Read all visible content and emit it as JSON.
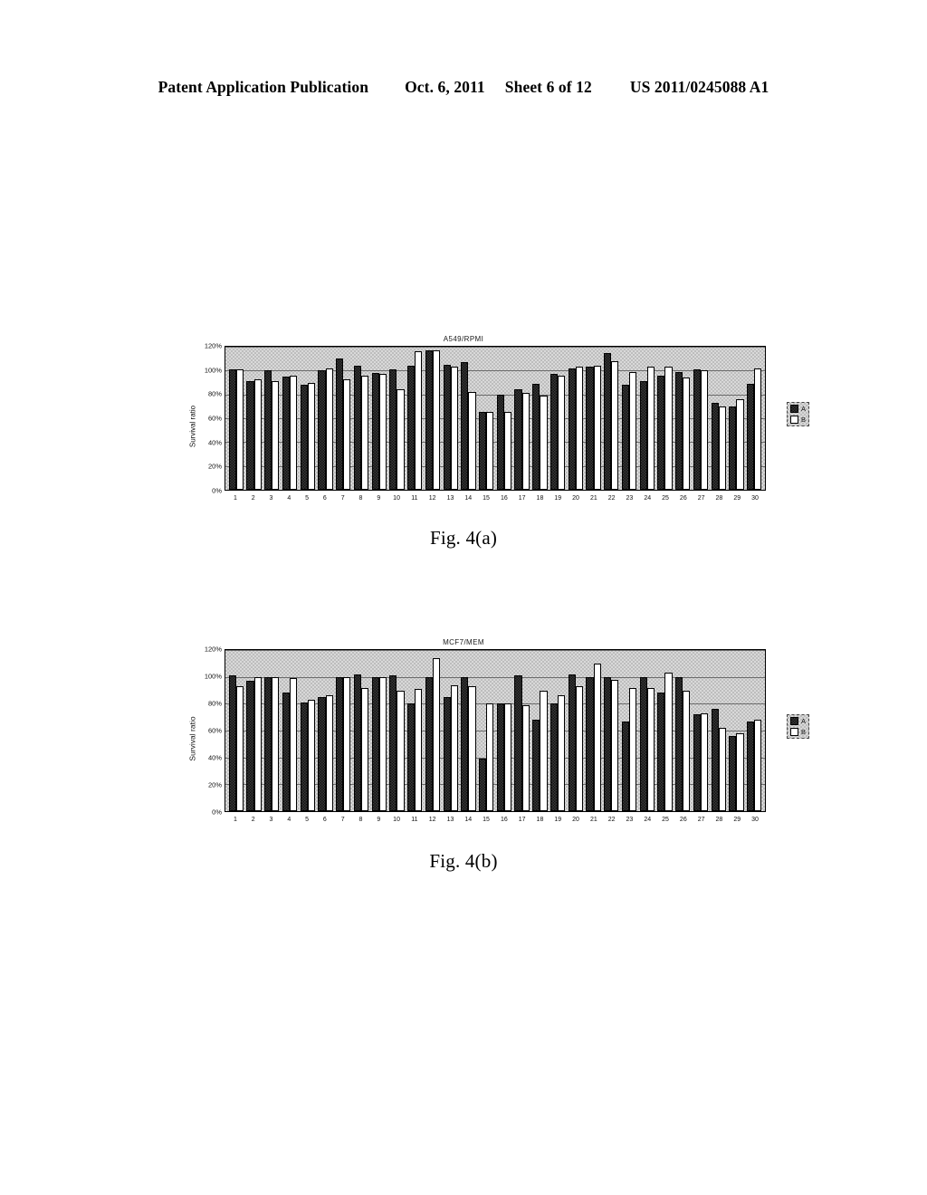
{
  "header": {
    "publication": "Patent Application Publication",
    "date": "Oct. 6, 2011",
    "sheet": "Sheet 6 of 12",
    "number": "US 2011/0245088 A1"
  },
  "figures": [
    {
      "caption": "Fig. 4(a)",
      "chart_data": {
        "type": "bar",
        "title": "A549/RPMI",
        "xlabel": "",
        "ylabel": "Survival ratio",
        "ylim": [
          0,
          120
        ],
        "ytick_labels": [
          "0%",
          "20%",
          "40%",
          "60%",
          "80%",
          "100%",
          "120%"
        ],
        "ytick_values": [
          0,
          20,
          40,
          60,
          80,
          100,
          120
        ],
        "grid": true,
        "legend_position": "right",
        "categories": [
          "1",
          "2",
          "3",
          "4",
          "5",
          "6",
          "7",
          "8",
          "9",
          "10",
          "11",
          "12",
          "13",
          "14",
          "15",
          "16",
          "17",
          "18",
          "19",
          "20",
          "21",
          "22",
          "23",
          "24",
          "25",
          "26",
          "27",
          "28",
          "29",
          "30"
        ],
        "series": [
          {
            "name": "A",
            "values": [
              101,
              91,
              100,
              95,
              88,
              100,
              110,
              104,
              98,
              101,
              104,
              117,
              105,
              107,
              65,
              80,
              84,
              89,
              97,
              102,
              103,
              115,
              88,
              91,
              96,
              99,
              101,
              73,
              70,
              89
            ]
          },
          {
            "name": "B",
            "values": [
              101,
              93,
              91,
              96,
              90,
              102,
              93,
              96,
              97,
              84,
              116,
              117,
              103,
              82,
              65,
              65,
              81,
              79,
              96,
              103,
              104,
              108,
              99,
              103,
              103,
              94,
              100,
              70,
              76,
              102
            ]
          }
        ]
      }
    },
    {
      "caption": "Fig. 4(b)",
      "chart_data": {
        "type": "bar",
        "title": "MCF7/MEM",
        "xlabel": "",
        "ylabel": "Survival ratio",
        "ylim": [
          0,
          120
        ],
        "ytick_labels": [
          "0%",
          "20%",
          "40%",
          "60%",
          "80%",
          "100%",
          "120%"
        ],
        "ytick_values": [
          0,
          20,
          40,
          60,
          80,
          100,
          120
        ],
        "grid": true,
        "legend_position": "right",
        "categories": [
          "1",
          "2",
          "3",
          "4",
          "5",
          "6",
          "7",
          "8",
          "9",
          "10",
          "11",
          "12",
          "13",
          "14",
          "15",
          "16",
          "17",
          "18",
          "19",
          "20",
          "21",
          "22",
          "23",
          "24",
          "25",
          "26",
          "27",
          "28",
          "29",
          "30"
        ],
        "series": [
          {
            "name": "A",
            "values": [
              101,
              97,
              100,
              88,
              81,
              85,
              100,
              102,
              100,
              101,
              80,
              100,
              85,
              100,
              39,
              80,
              101,
              68,
              80,
              102,
              100,
              100,
              67,
              100,
              88,
              100,
              72,
              76,
              56,
              67
            ]
          },
          {
            "name": "B",
            "values": [
              93,
              100,
              100,
              99,
              83,
              86,
              100,
              92,
              100,
              90,
              91,
              114,
              94,
              93,
              80,
              80,
              79,
              90,
              86,
              93,
              110,
              98,
              92,
              92,
              103,
              90,
              73,
              62,
              58,
              68
            ]
          }
        ]
      }
    }
  ]
}
